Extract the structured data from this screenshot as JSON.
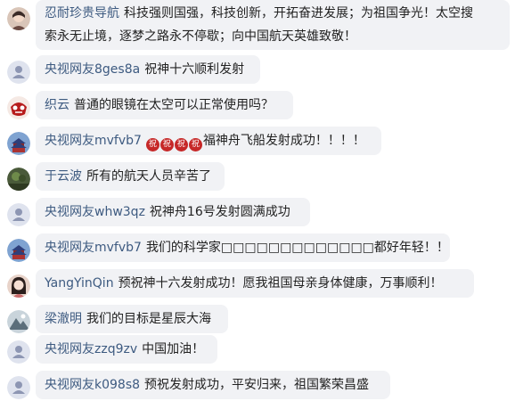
{
  "comments": [
    {
      "user": "忍耐珍贵导航",
      "avatar_icon": "user-photo-avatar-icon",
      "text_line1": "科技强则国强，科技创新，开拓奋进发展；为祖国争光！太空搜",
      "text_line2": "索永无止境，逐梦之路永不停歇；向中国航天英雄致敬！"
    },
    {
      "user": "央视网友8ges8a",
      "avatar_icon": "default-user-avatar-icon",
      "text": "祝神十六顺利发射"
    },
    {
      "user": "织云",
      "avatar_icon": "red-mask-avatar-icon",
      "text": "普通的眼镜在太空可以正常使用吗？"
    },
    {
      "user": "央视网友mvfvb7",
      "avatar_icon": "temple-avatar-icon",
      "emoji_char": "祝",
      "emoji_count": 4,
      "text": "福神舟飞船发射成功！！！！"
    },
    {
      "user": "于云波",
      "avatar_icon": "landscape-avatar-icon",
      "text": "所有的航天人员辛苦了"
    },
    {
      "user": "央视网友whw3qz",
      "avatar_icon": "default-user-avatar-icon",
      "text": "祝神舟16号发射圆满成功"
    },
    {
      "user": "央视网友mvfvb7",
      "avatar_icon": "temple-avatar-icon",
      "text": "我们的科学家□□□□□□□□□□□□□都好年轻！！！！"
    },
    {
      "user": "YangYinQin",
      "avatar_icon": "user-photo-avatar-icon",
      "text": "预祝神十六发射成功！愿我祖国母亲身体健康，万事顺利！"
    },
    {
      "user": "梁澈明",
      "avatar_icon": "mountain-avatar-icon",
      "text": "我们的目标是星辰大海"
    },
    {
      "user": "央视网友zzq9zv",
      "avatar_icon": "default-user-avatar-icon",
      "text": "中国加油！"
    },
    {
      "user": "央视网友k098s8",
      "avatar_icon": "default-user-avatar-icon",
      "text": "预祝发射成功，平安归来，祖国繁荣昌盛"
    }
  ]
}
